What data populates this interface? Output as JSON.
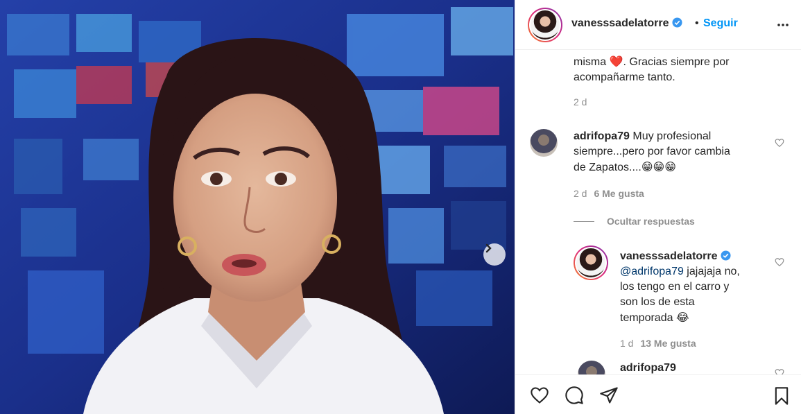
{
  "post": {
    "username": "vanesssadelatorre",
    "separator": "•",
    "follow_label": "Seguir",
    "more_icon": "more-horizontal-icon"
  },
  "caption": {
    "text_line1": "misma",
    "heart_emoji": "❤️",
    "text_line1_rest": ". Gracias siempre por",
    "text_line2": "acompañarme tanto.",
    "time": "2 d"
  },
  "comments": [
    {
      "username": "adrifopa79",
      "text_line1": " Muy profesional",
      "text_line2": "siempre...pero por favor cambia",
      "text_line3": "de Zapatos....",
      "emojis": "😁😁😁",
      "time": "2 d",
      "likes": "6 Me gusta"
    }
  ],
  "hide_replies_label": "Ocultar respuestas",
  "reply": {
    "username": "vanesssadelatorre",
    "mention": "@adrifopa79",
    "text_line1": " jajajaja no,",
    "text_line2": "los tengo en el carro y",
    "text_line3": "son los de esta",
    "text_line4": "temporada",
    "emoji": "😂",
    "time": "1 d",
    "likes": "13 Me gusta"
  },
  "next_reply": {
    "username": "adrifopa79"
  },
  "colors": {
    "accent": "#0095f6",
    "text": "#262626",
    "secondary": "#8e8e8e",
    "mention": "#00376b",
    "border": "#efefef",
    "heart_red": "#ed4956"
  }
}
